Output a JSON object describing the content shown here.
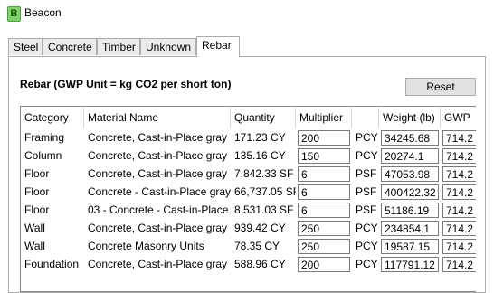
{
  "window": {
    "title": "Beacon",
    "icon_letter": "B"
  },
  "tabs": [
    {
      "label": "Steel"
    },
    {
      "label": "Concrete"
    },
    {
      "label": "Timber"
    },
    {
      "label": "Unknown"
    },
    {
      "label": "Rebar"
    }
  ],
  "active_tab": "Rebar",
  "panel": {
    "heading": "Rebar (GWP Unit = kg CO2 per short ton)",
    "reset_label": "Reset"
  },
  "table": {
    "columns": [
      "Category",
      "Material Name",
      "Quantity",
      "Multiplier",
      "",
      "Weight (lb)",
      "GWP"
    ],
    "rows": [
      {
        "category": "Framing",
        "material": "Concrete, Cast-in-Place gray",
        "quantity": "171.23 CY",
        "multiplier": "200",
        "unit": "PCY",
        "weight": "34245.68",
        "gwp": "714.2"
      },
      {
        "category": "Column",
        "material": "Concrete, Cast-in-Place gray",
        "quantity": "135.16 CY",
        "multiplier": "150",
        "unit": "PCY",
        "weight": "20274.1",
        "gwp": "714.2"
      },
      {
        "category": "Floor",
        "material": "Concrete, Cast-in-Place gray",
        "quantity": "7,842.33 SF",
        "multiplier": "6",
        "unit": "PSF",
        "weight": "47053.98",
        "gwp": "714.2"
      },
      {
        "category": "Floor",
        "material": "Concrete - Cast-in-Place gray",
        "quantity": "66,737.05 SF",
        "multiplier": "6",
        "unit": "PSF",
        "weight": "400422.32",
        "gwp": "714.2"
      },
      {
        "category": "Floor",
        "material": "03 - Concrete - Cast-in-Place",
        "quantity": "8,531.03 SF",
        "multiplier": "6",
        "unit": "PSF",
        "weight": "51186.19",
        "gwp": "714.2"
      },
      {
        "category": "Wall",
        "material": "Concrete, Cast-in-Place gray",
        "quantity": "939.42 CY",
        "multiplier": "250",
        "unit": "PCY",
        "weight": "234854.1",
        "gwp": "714.2"
      },
      {
        "category": "Wall",
        "material": "Concrete Masonry Units",
        "quantity": "78.35 CY",
        "multiplier": "250",
        "unit": "PCY",
        "weight": "19587.15",
        "gwp": "714.2"
      },
      {
        "category": "Foundation",
        "material": "Concrete, Cast-in-Place gray",
        "quantity": "588.96 CY",
        "multiplier": "200",
        "unit": "PCY",
        "weight": "117791.12",
        "gwp": "714.2"
      }
    ]
  }
}
